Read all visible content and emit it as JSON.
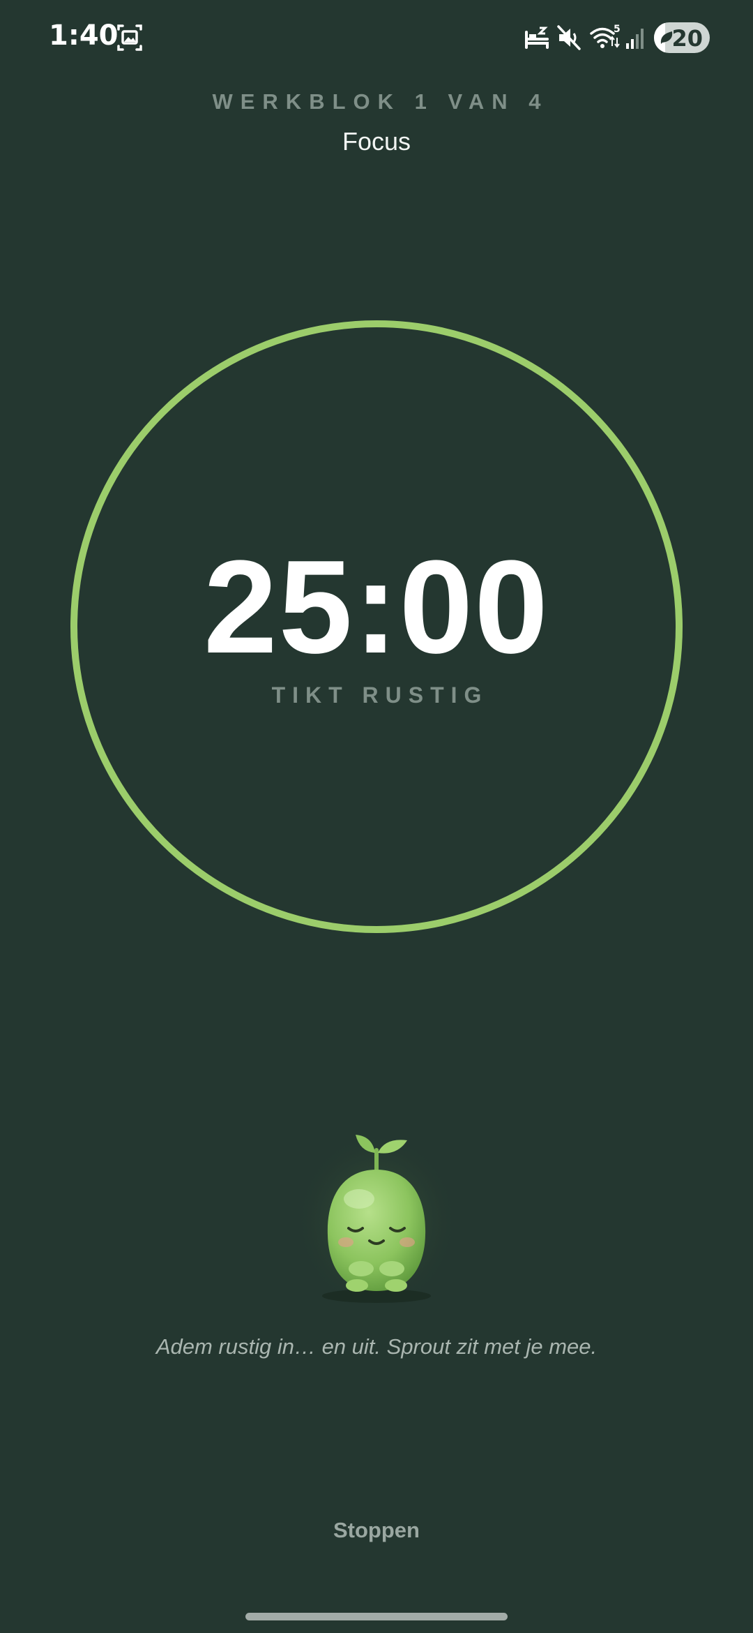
{
  "status_bar": {
    "time": "1:40",
    "battery_level": "20",
    "icons": [
      "screenshot-icon",
      "sleep-mode-icon",
      "mute-icon",
      "wifi-icon",
      "signal-icon",
      "battery-saver-icon"
    ]
  },
  "header": {
    "block_label": "WERKBLOK 1 VAN 4",
    "mode_title": "Focus"
  },
  "timer": {
    "value": "25:00",
    "status": "TIKT RUSTIG",
    "progress": 1.0
  },
  "mascot": {
    "icon": "sprout-mascot-icon"
  },
  "breath_text": "Adem rustig in… en uit. Sprout zit met je mee.",
  "actions": {
    "stop_label": "Stoppen"
  },
  "colors": {
    "background": "#243730",
    "ring": "#9ccd6b",
    "mascot": "#8cc45e",
    "muted_text": "#7f8f88"
  }
}
